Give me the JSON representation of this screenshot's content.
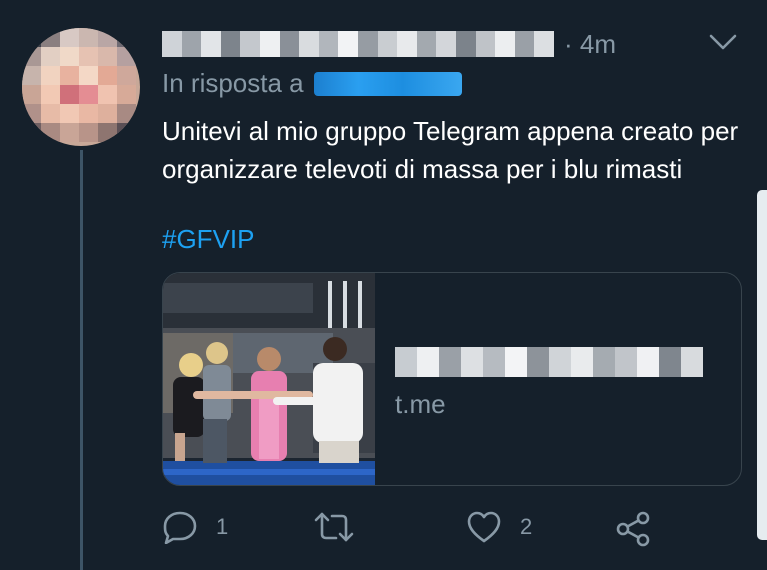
{
  "tweet": {
    "time": "· 4m",
    "reply_prefix": "In risposta a",
    "text": "Unitevi al mio gruppo Telegram appena creato per organizzare televoti di massa per i blu rimasti",
    "hashtag": "#GFVIP",
    "card": {
      "domain": "t.me"
    },
    "actions": {
      "reply_count": "1",
      "like_count": "2"
    }
  },
  "icons": [
    "chevron-down-icon",
    "reply-icon",
    "retweet-icon",
    "like-icon",
    "share-icon"
  ],
  "colors": {
    "background": "#15202b",
    "accent": "#1da1f2",
    "secondary_text": "#8899a6",
    "border": "#38444d"
  }
}
